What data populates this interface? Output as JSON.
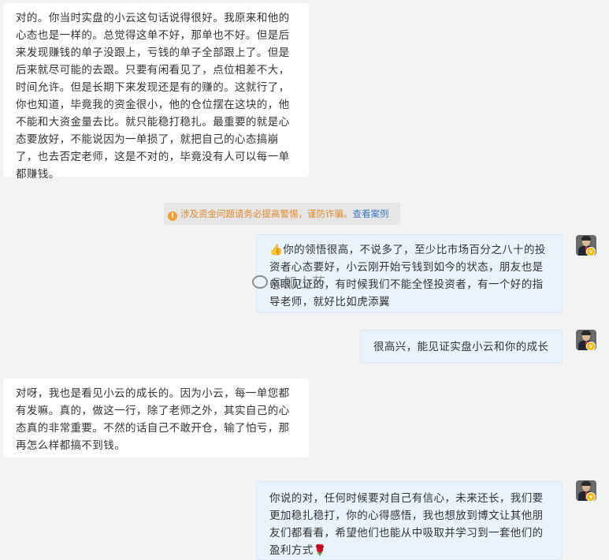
{
  "messages": {
    "m1": "对的。你当时实盘的小云这句话说得很好。我原来和他的心态也是一样的。总觉得这单不好，那单也不好。但是后来发现赚钱的单子没跟上，亏钱的单子全部跟上了。但是后来就尽可能的去跟。只要有闲看见了，点位相差不大，时间允许。但是长期下来发现还是有的赚的。这就行了，你也知道，毕竟我的资金很小，他的仓位摆在这块的，他不能和大资金量去比。就只能稳打稳扎。最重要的就是心态要放好，不能说因为一单损了，就把自己的心态搞崩了，也去否定老师，这是不对的，毕竟没有人可以每一单都赚钱。",
    "m2_emoji": "👍",
    "m2": "你的领悟很高，不说多了，至少比市场百分之八十的投资者心态要好，小云刚开始亏钱到如今的状态，朋友也是亲眼见证的，有时候我们不能全怪投资者，有一个好的指导老师，就好比如虎添翼",
    "m3": "很高兴，能见证实盘小云和你的成长",
    "m4": "对呀，我也是看见小云的成长的。因为小云，每一单您都有发嘛。真的，做这一行，除了老师之外，其实自己的心态真的非常重要。不然的话自己不敢开仓，输了怕亏，那再怎么样都搞不到钱。",
    "m5": "你说的对，任何时候要对自己有信心，未来还长，我们要更加稳扎稳打，你的心得感悟，我也想放到博文让其他朋友们都看看，希望他们也能从中吸取并学习到一套他们的盈利方式",
    "m5_emoji": "🌹"
  },
  "notice": {
    "icon": "!",
    "text": "涉及资金问题请务必提高警惕，谨防诈骗。",
    "link": "查看案例"
  },
  "watermark": "@知小莎",
  "badge": "v"
}
